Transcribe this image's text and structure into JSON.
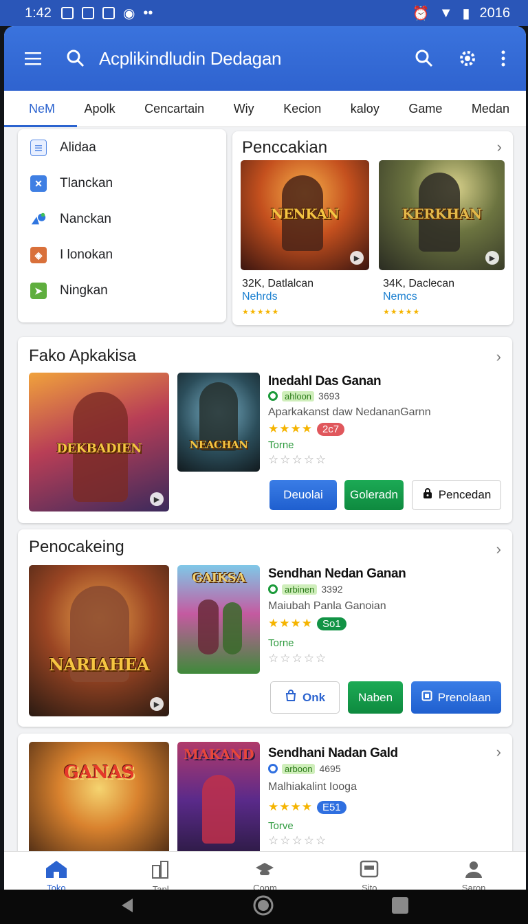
{
  "status": {
    "time": "1:42",
    "year": "2016"
  },
  "appbar": {
    "title": "Acplikindludin Dedagan"
  },
  "tabs": [
    "NeM",
    "Apolk",
    "Cencartain",
    "Wiy",
    "Kecion",
    "kaloy",
    "Game",
    "Medan"
  ],
  "menu": [
    {
      "label": "Alidaa",
      "icon": "document-icon",
      "color": "#5b8de6"
    },
    {
      "label": "Tlanckan",
      "icon": "tools-icon",
      "color": "#3f7fe3"
    },
    {
      "label": "Nanckan",
      "icon": "shapes-icon",
      "color": "#2f76e0"
    },
    {
      "label": "I lonokan",
      "icon": "shield-icon",
      "color": "#d9703a"
    },
    {
      "label": "Ningkan",
      "icon": "play-icon",
      "color": "#5fae3e"
    }
  ],
  "featured": {
    "title": "Penccakian",
    "items": [
      {
        "logo": "NENKAN",
        "meta": "32K,  Datlalcan",
        "sub": "Nehrds"
      },
      {
        "logo": "KERKHAN",
        "meta": "34K, Daclecan",
        "sub": "Nemcs"
      }
    ]
  },
  "sections": [
    {
      "title": "Fako Apkakisa",
      "logos": [
        "DEKBADIEN",
        "NEACHAN"
      ],
      "app_name": "Inedahl Das Ganan",
      "pill": "ahloon",
      "count": "3693",
      "desc": "Aparkakanst daw NedananGarnn",
      "rating_chip": "2c7",
      "chip_color": "#e0575c",
      "tag": "Torne",
      "buttons": [
        {
          "label": "Deuolai",
          "style": "blue"
        },
        {
          "label": "Goleradn",
          "style": "green"
        },
        {
          "label": "Pencedan",
          "style": "outline",
          "icon": "lock-icon"
        }
      ]
    },
    {
      "title": "Penocakeing",
      "logos": [
        "NARIAHEA",
        "GAIKSA"
      ],
      "app_name": "Sendhan Nedan Ganan",
      "pill": "arbinen",
      "count": "3392",
      "desc": "Maiubah Panla Ganoian",
      "rating_chip": "So1",
      "chip_color": "#129345",
      "tag": "Torne",
      "buttons": [
        {
          "label": "Onk",
          "style": "outline",
          "icon": "bag-icon"
        },
        {
          "label": "Naben",
          "style": "green"
        },
        {
          "label": "Prenolaan",
          "style": "blue",
          "icon": "square-icon"
        }
      ]
    },
    {
      "logos": [
        "GANAS",
        "MAKAND"
      ],
      "app_name": "Sendhani Nadan Gald",
      "pill": "arboon",
      "count": "4695",
      "desc": "Malhiakalint Iooga",
      "rating_chip": "E51",
      "chip_color": "#2f6fe0",
      "tag": "Torve"
    }
  ],
  "bottomnav": [
    {
      "label": "Toko",
      "icon": "home-icon"
    },
    {
      "label": "Tapl",
      "icon": "apps-icon"
    },
    {
      "label": "Conm",
      "icon": "cloud-icon"
    },
    {
      "label": "Sito",
      "icon": "inbox-icon"
    },
    {
      "label": "Saron",
      "icon": "person-icon"
    }
  ]
}
